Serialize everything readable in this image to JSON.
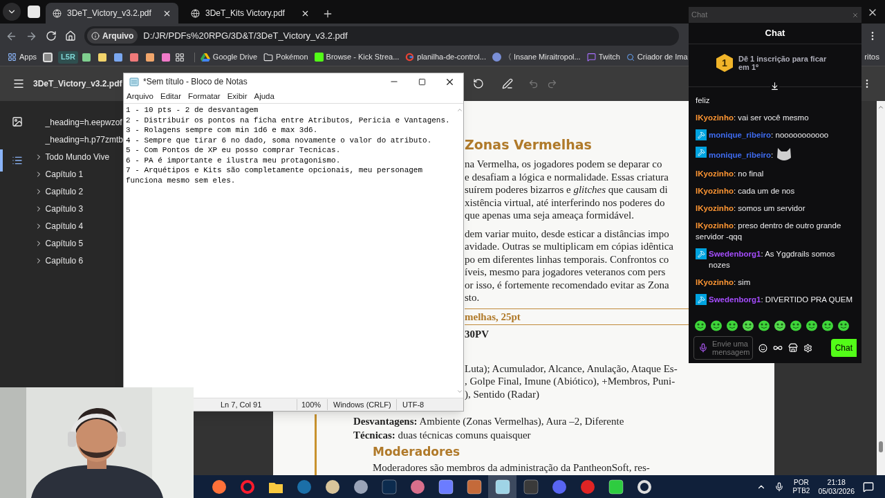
{
  "browser": {
    "tabs": [
      {
        "title": "3DeT_Victory_v3.2.pdf",
        "selected": true
      },
      {
        "title": "3DeT_Kits Victory.pdf",
        "selected": false
      }
    ],
    "address": {
      "chip": "Arquivo",
      "url": "D:/JR/PDFs%20RPG/3D&T/3DeT_Victory_v3.2.pdf"
    },
    "bookmarks": [
      {
        "kind": "apps",
        "label": "Apps"
      },
      {
        "kind": "square"
      },
      {
        "kind": "badge",
        "label": "L5R"
      },
      {
        "kind": "swatch",
        "color": "#7fcf8f"
      },
      {
        "kind": "swatch",
        "color": "#f2d46b"
      },
      {
        "kind": "swatch",
        "color": "#7aa7f0"
      },
      {
        "kind": "swatch",
        "color": "#f07a7a"
      },
      {
        "kind": "swatch",
        "color": "#f2a66b"
      },
      {
        "kind": "swatch",
        "color": "#f07ac8"
      },
      {
        "kind": "grid"
      },
      {
        "kind": "triangle",
        "label": "Google Drive"
      },
      {
        "kind": "folder",
        "label": "Pokémon"
      },
      {
        "kind": "green",
        "label": "Browse - Kick Strea..."
      },
      {
        "kind": "ring",
        "label": "planilha-de-control..."
      },
      {
        "kind": "emblem",
        "label": "〈 Insane Miraitropol..."
      },
      {
        "kind": "bubble",
        "label": "Twitch"
      },
      {
        "kind": "search",
        "label": "Criador de Ima"
      }
    ],
    "bookmarks_end": "ritos"
  },
  "pdf": {
    "title": "3DeT_Victory_v3.2.pdf",
    "sidebar_tabs": [
      {
        "kind": "thumbnails",
        "selected": false
      },
      {
        "kind": "outline",
        "selected": true
      }
    ],
    "outline": [
      {
        "label": "_heading=h.eepwzof"
      },
      {
        "label": "_heading=h.p77zmtb"
      },
      {
        "label": "Todo Mundo Vive",
        "expanded": false
      },
      {
        "label": "Capítulo 1",
        "expanded": false
      },
      {
        "label": "Capítulo 2",
        "expanded": false
      },
      {
        "label": "Capítulo 3",
        "expanded": false
      },
      {
        "label": "Capítulo 4",
        "expanded": false
      },
      {
        "label": "Capítulo 5",
        "expanded": false
      },
      {
        "label": "Capítulo 6",
        "expanded": false
      }
    ],
    "page": {
      "heading": "Zonas Vermelhas",
      "paragraphs": [
        [
          "na Vermelha, os jogadores podem se deparar co",
          "e desafiam a lógica e normalidade. Essas criatura",
          "suírem poderes bizarros e *glitches* que causam di",
          "xistência virtual, até interferindo nos poderes do",
          "que apenas uma seja ameaça formidável."
        ],
        [
          "dem variar muito, desde esticar a distâncias impo",
          "avidade. Outras se multiplicam em cópias idêntica",
          "po em diferentes linhas temporais. Confrontos co",
          "íveis, mesmo para jogadores veteranos com pers",
          "or isso, é fortemente recomendado evitar as Zona",
          "sto."
        ]
      ],
      "stat_heading": "melhas, 25pt",
      "stat_line": "30PV",
      "abilities": [
        "Luta); Acumulador, Alcance, Anulação, Ataque Es-",
        ", Golpe Final, Imune (Abiótico), +Membros, Puni-",
        "), Sentido (Radar)"
      ],
      "traits": [
        "**Desvantagens:** Ambiente (Zonas Vermelhas), Aura –2, Diferente",
        "**Técnicas:** duas técnicas comuns quaisquer"
      ],
      "section_heading": "Moderadores",
      "section_text": "Moderadores são membros da administração da PantheonSoft, res-"
    }
  },
  "notepad": {
    "title": "*Sem título - Bloco de Notas",
    "menu": [
      "Arquivo",
      "Editar",
      "Formatar",
      "Exibir",
      "Ajuda"
    ],
    "lines": [
      "1 - 10 pts - 2 de desvantagem",
      "2 - Distribuir os pontos na ficha entre Atributos, Pericia e Vantagens.",
      "3 - Rolagens sempre com min 1d6 e max 3d6.",
      "4 - Sempre que tirar 6 no dado, soma novamente o valor do atributo.",
      "5 - Com Pontos de XP eu posso comprar Tecnicas.",
      "6 - PA é importante e ilustra meu protagonismo.",
      "7 - Arquétipos e Kits são completamente opcionais, meu personagem funciona mesmo sem eles."
    ],
    "status": [
      "Ln 7, Col 91",
      "100%",
      "Windows (CRLF)",
      "UTF-8"
    ]
  },
  "chat": {
    "window_title": "Chat",
    "title": "Chat",
    "banner": {
      "rank": "1",
      "text": "Dê 1 inscrição para ficar em 1º"
    },
    "messages": [
      {
        "kind": "text",
        "text": "feliz"
      },
      {
        "kind": "text",
        "user": "IKyozinho",
        "color": "#ff9633",
        "mod": false,
        "text": ": vai ser você mesmo"
      },
      {
        "kind": "text",
        "user": "monique_ribeiro",
        "color": "#3f6cf0",
        "mod": true,
        "text": ": nooooooooooo"
      },
      {
        "kind": "emote",
        "user": "monique_ribeiro",
        "color": "#3f6cf0",
        "mod": true,
        "text": ":"
      },
      {
        "kind": "text",
        "user": "IKyozinho",
        "color": "#ff9633",
        "mod": false,
        "text": ": no final"
      },
      {
        "kind": "text",
        "user": "IKyozinho",
        "color": "#ff9633",
        "mod": false,
        "text": ": cada um de nos"
      },
      {
        "kind": "text",
        "user": "IKyozinho",
        "color": "#ff9633",
        "mod": false,
        "text": ": somos um servidor"
      },
      {
        "kind": "text",
        "user": "IKyozinho",
        "color": "#ff9633",
        "mod": false,
        "text": ": preso dentro de outro grande servidor -qqq"
      },
      {
        "kind": "text",
        "user": "Swedenborg1",
        "color": "#a64dff",
        "mod": true,
        "text": ": As Yggdrails somos nozes"
      },
      {
        "kind": "text",
        "user": "IKyozinho",
        "color": "#ff9633",
        "mod": false,
        "text": ": sim"
      },
      {
        "kind": "text",
        "user": "Swedenborg1",
        "color": "#a64dff",
        "mod": true,
        "text": ": DIVERTIDO PRA QUEM"
      }
    ],
    "input": {
      "placeholder": "Envie uma mensagem"
    },
    "send": "Chat"
  },
  "taskbar": {
    "apps": [
      {
        "kind": "fox",
        "selected": false
      },
      {
        "kind": "ring",
        "selected": false
      },
      {
        "kind": "folder",
        "selected": false
      },
      {
        "kind": "steam",
        "selected": false
      },
      {
        "kind": "palette",
        "selected": false
      },
      {
        "kind": "pad",
        "selected": false
      },
      {
        "kind": "ps",
        "selected": false
      },
      {
        "kind": "brush",
        "selected": false
      },
      {
        "kind": "gamepad",
        "selected": false
      },
      {
        "kind": "avatar",
        "selected": false
      },
      {
        "kind": "notepad",
        "selected": true
      },
      {
        "kind": "calendar",
        "selected": false
      },
      {
        "kind": "discord",
        "selected": false
      },
      {
        "kind": "punch",
        "selected": false
      },
      {
        "kind": "bolt",
        "selected": false
      },
      {
        "kind": "obs",
        "selected": false
      }
    ],
    "tray": {
      "lang": "POR",
      "layout": "PTB2",
      "time": "21:18",
      "date": "05/03/2026"
    }
  }
}
